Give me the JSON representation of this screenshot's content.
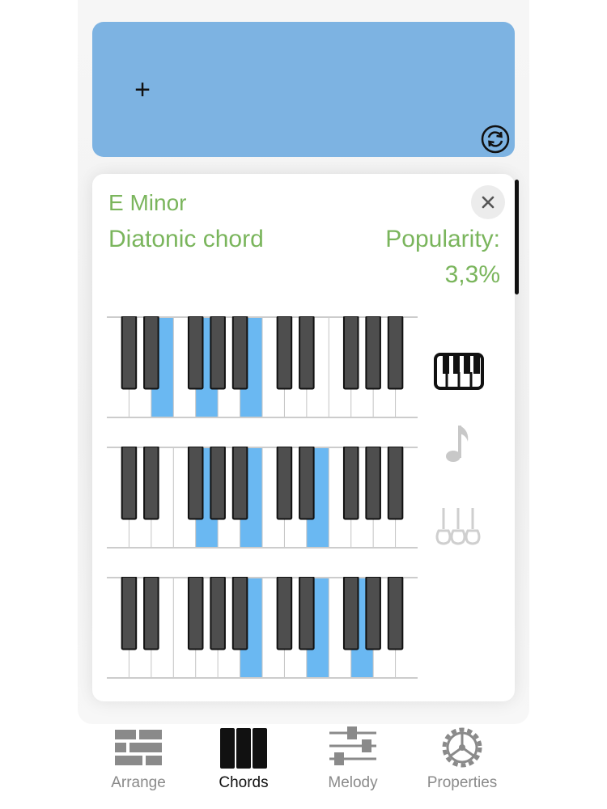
{
  "slot": {
    "add_glyph": "+",
    "refresh_icon": "refresh-circle-icon",
    "color": "#7db3e2"
  },
  "chord_panel": {
    "name": "E Minor",
    "type": "Diatonic chord",
    "popularity_label": "Popularity:",
    "popularity_value": "3,3%",
    "text_color": "#7ab55c",
    "close_icon": "close-icon"
  },
  "voicings": [
    {
      "highlighted_white_keys": [
        2,
        4,
        6
      ]
    },
    {
      "highlighted_white_keys": [
        4,
        6,
        9
      ]
    },
    {
      "highlighted_white_keys": [
        6,
        9,
        11
      ]
    }
  ],
  "keyboard_highlight_color": "#6ab8f2",
  "view_modes": [
    {
      "name": "piano-view",
      "icon": "piano-icon",
      "active": true
    },
    {
      "name": "notation-view",
      "icon": "music-note-icon",
      "active": false
    },
    {
      "name": "guitar-view",
      "icon": "guitar-icon",
      "active": false
    }
  ],
  "tabs": [
    {
      "label": "Arrange",
      "icon": "arrange-bricks-icon",
      "active": false
    },
    {
      "label": "Chords",
      "icon": "chords-bars-icon",
      "active": true
    },
    {
      "label": "Melody",
      "icon": "melody-sliders-icon",
      "active": false
    },
    {
      "label": "Properties",
      "icon": "gear-icon",
      "active": false
    }
  ]
}
